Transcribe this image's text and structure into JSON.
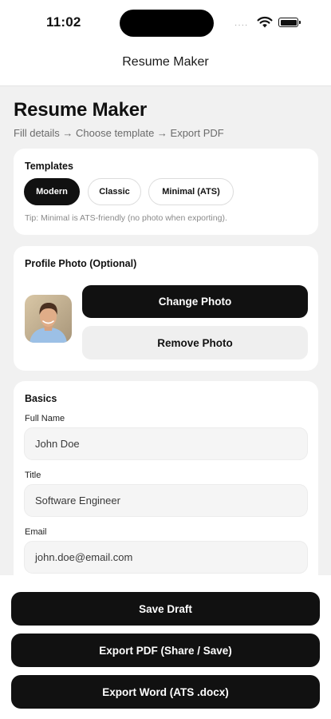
{
  "status_bar": {
    "time": "11:02",
    "signal": "····"
  },
  "nav": {
    "title": "Resume Maker"
  },
  "header": {
    "title": "Resume Maker",
    "subtitle": "Fill details → Choose template → Export PDF"
  },
  "templates": {
    "title": "Templates",
    "options": [
      {
        "label": "Modern",
        "selected": true
      },
      {
        "label": "Classic",
        "selected": false
      },
      {
        "label": "Minimal (ATS)",
        "selected": false
      }
    ],
    "tip": "Tip: Minimal is ATS-friendly (no photo when exporting)."
  },
  "photo": {
    "title": "Profile Photo (Optional)",
    "change_label": "Change Photo",
    "remove_label": "Remove Photo"
  },
  "basics": {
    "title": "Basics",
    "fields": [
      {
        "label": "Full Name",
        "value": "John Doe"
      },
      {
        "label": "Title",
        "value": "Software Engineer"
      },
      {
        "label": "Email",
        "value": "john.doe@email.com"
      }
    ]
  },
  "actions": {
    "save_draft": "Save Draft",
    "export_pdf": "Export PDF (Share / Save)",
    "export_word": "Export Word (ATS .docx)"
  },
  "colors": {
    "primary": "#111111",
    "background": "#f1f1f1",
    "card": "#ffffff",
    "secondary_button": "#efefef"
  }
}
